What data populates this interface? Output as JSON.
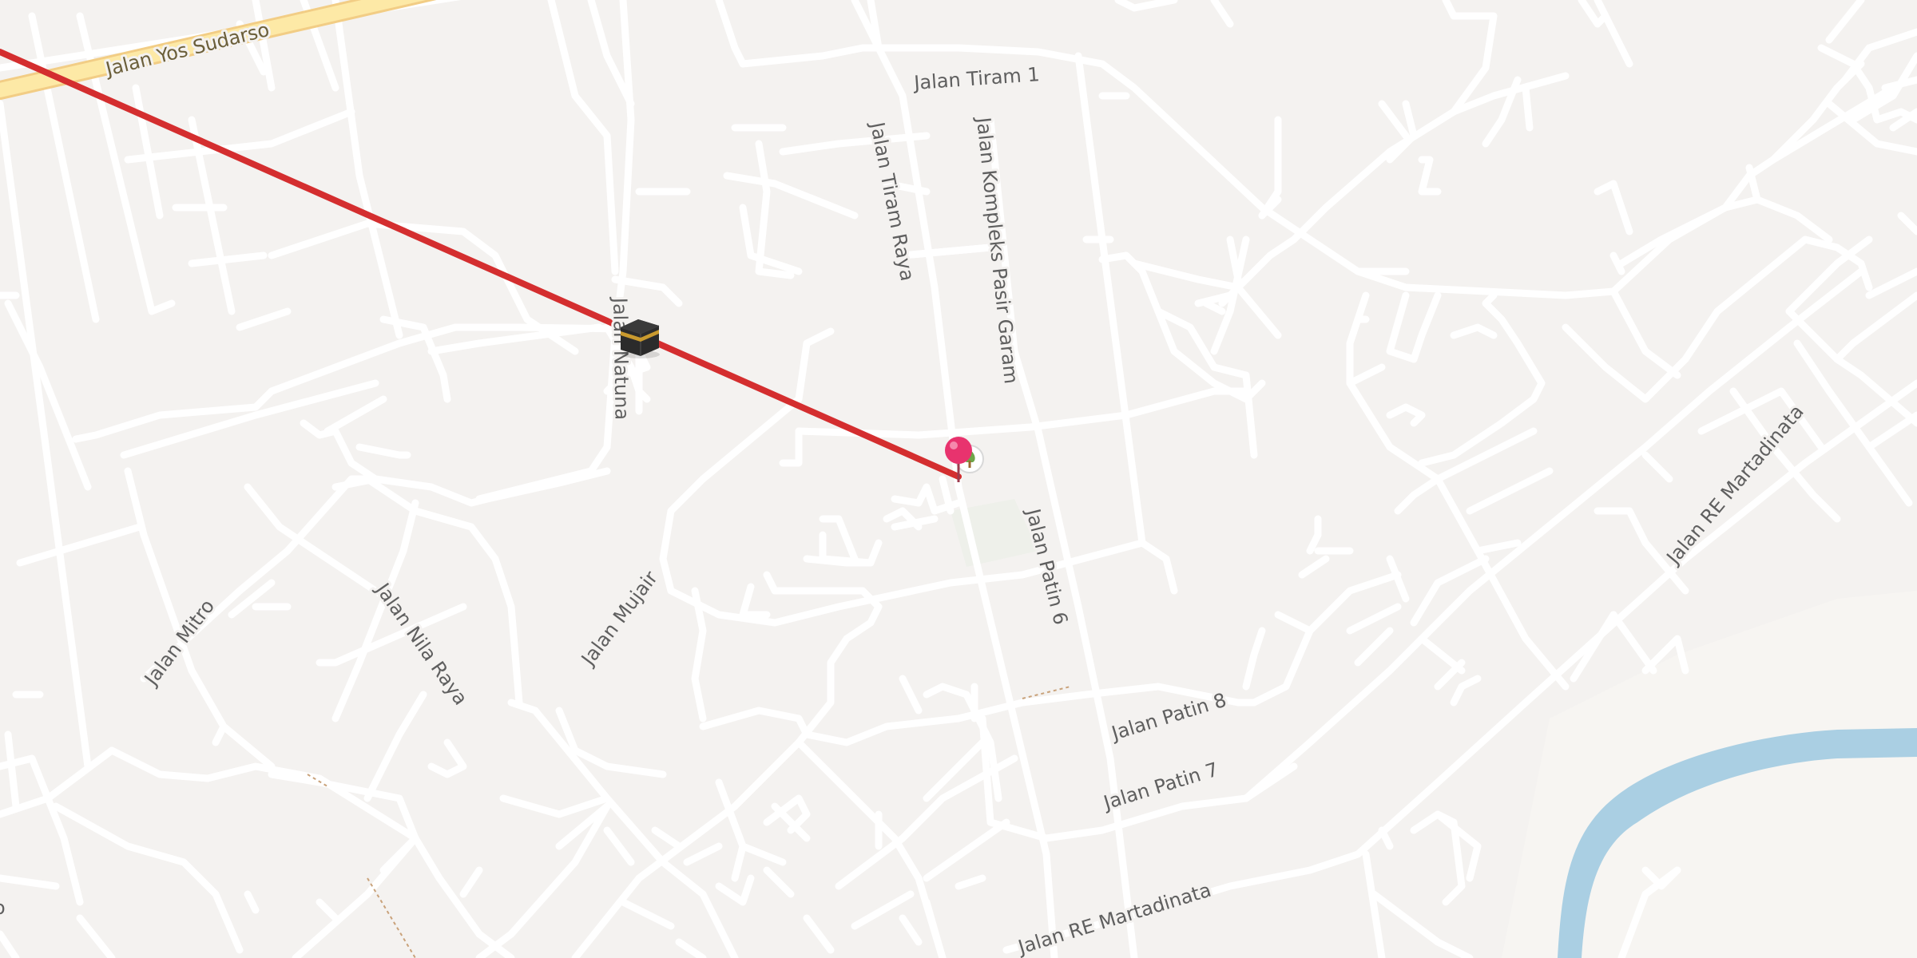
{
  "map": {
    "labels": {
      "yos_sudarso": "Jalan Yos Sudarso",
      "tiram_1": "Jalan Tiram 1",
      "tiram_raya": "Jalan Tiram Raya",
      "kompleks_pasir_garam": "Jalan Kompleks Pasir Garam",
      "natuna": "Jalan Natuna",
      "mujair": "Jalan Mujair",
      "mitro": "Jalan Mitro",
      "nila_raya": "Jalan Nila Raya",
      "patin_6": "Jalan Patin 6",
      "patin_8": "Jalan Patin 8",
      "patin_7": "Jalan Patin 7",
      "re_martadinata_1": "Jalan RE Martadinata",
      "re_martadinata_2": "Jalan RE Martadinata"
    },
    "colors": {
      "background": "#f4f2f0",
      "road": "#ffffff",
      "major_road": "#fde9a6",
      "route_line": "#d42e2f",
      "river": "#aacfe3",
      "pin": "#e8336e"
    },
    "markers": {
      "kaaba_icon": "kaaba-icon",
      "location_pin_icon": "location-pin-icon",
      "park_icon": "park-icon"
    }
  }
}
